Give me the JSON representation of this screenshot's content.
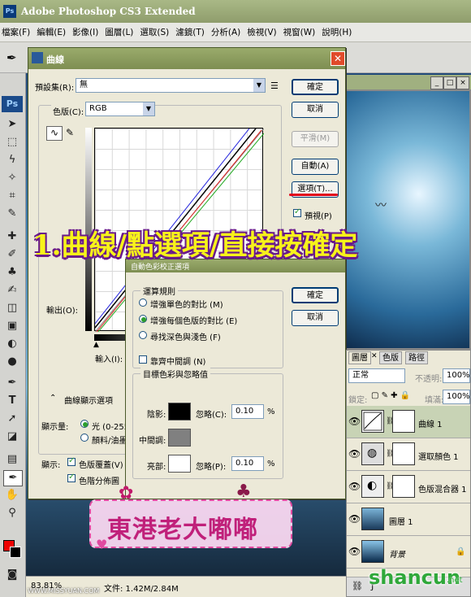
{
  "app": {
    "icon": "Ps",
    "title": "Adobe Photoshop CS3 Extended"
  },
  "menu": [
    "檔案(F)",
    "編輯(E)",
    "影像(I)",
    "圖層(L)",
    "選取(S)",
    "濾鏡(T)",
    "分析(A)",
    "檢視(V)",
    "視窗(W)",
    "說明(H)"
  ],
  "curves": {
    "title": "曲線",
    "preset_label": "預設集(R):",
    "preset_value": "無",
    "channel_label": "色版(C):",
    "channel_value": "RGB",
    "output_label": "輸出(O):",
    "input_label": "輸入(I):",
    "display_options": "曲線顯示選項",
    "show_amount_label": "顯示量:",
    "light_option": "光 (0-255",
    "pigment_option": "顏料/油墨",
    "show_label": "顯示:",
    "channel_overlay": "色版覆蓋(V)",
    "histogram": "色階分佈圖",
    "buttons": {
      "ok": "確定",
      "cancel": "取消",
      "smooth": "平滑(M)",
      "auto": "自動(A)",
      "options": "選項(T)...",
      "preview": "預視(P)"
    }
  },
  "auto_options": {
    "title": "自動色彩校正選項",
    "algorithms_group": "運算規則",
    "radio1": "增強單色的對比 (M)",
    "radio2": "增強每個色版的對比 (E)",
    "radio3": "尋找深色與淺色 (F)",
    "snap_neutral": "靠齊中間調 (N)",
    "targets_group": "目標色彩與忽略值",
    "shadows": "陰影:",
    "midtones": "中間調:",
    "highlights": "亮部:",
    "clip1_label": "忽略(C):",
    "clip1_value": "0.10",
    "clip2_label": "忽略(P):",
    "clip2_value": "0.10",
    "percent": "%",
    "ok": "確定",
    "cancel": "取消"
  },
  "annotation": "1.曲線/點選項/直接按確定",
  "layers_panel": {
    "tabs": [
      "圖層",
      "色版",
      "路徑"
    ],
    "blend": "正常",
    "opacity_label": "不透明:",
    "opacity": "100%",
    "lock_label": "鎖定:",
    "fill_label": "填滿:",
    "fill": "100%",
    "layers": [
      {
        "name": "曲線 1",
        "selected": true
      },
      {
        "name": "選取顏色 1",
        "selected": false
      },
      {
        "name": "色版混合器 1",
        "selected": false
      },
      {
        "name": "圖層 1",
        "selected": false
      },
      {
        "name": "背景",
        "selected": false
      }
    ]
  },
  "status": {
    "zoom": "83.81%",
    "doc": "文件: 1.42M/2.84M"
  },
  "watermark": {
    "logo_text": "東港老大嘟嘟",
    "site": "shancun",
    "site_suffix": ".net",
    "url": "WWW.MISSYUAN.COM"
  },
  "colors": {
    "accent_red": "#e0001a",
    "annotation_yellow": "#f7f31a",
    "annotation_outline": "#6a1a8a",
    "titlebar": "#9aab6c"
  }
}
